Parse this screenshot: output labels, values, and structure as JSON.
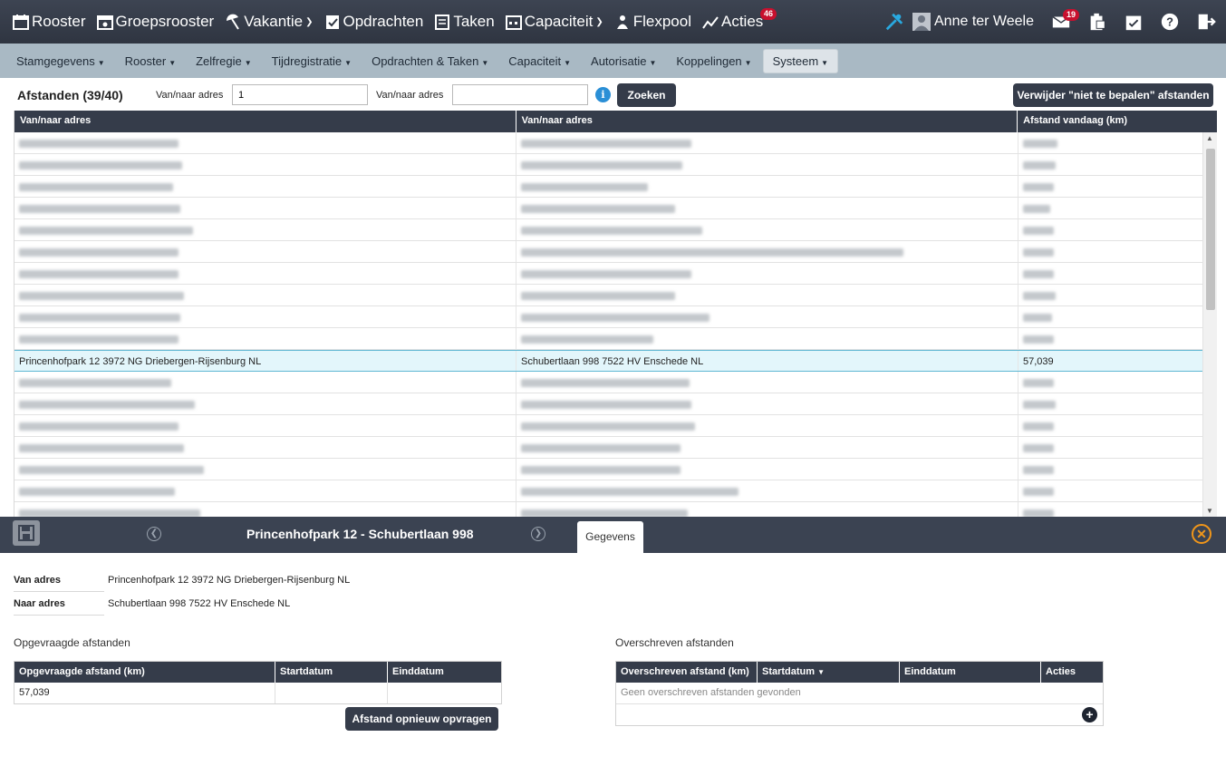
{
  "topnav": [
    {
      "label": "Rooster",
      "icon": "calendar-icon"
    },
    {
      "label": "Groepsrooster",
      "icon": "group-calendar-icon"
    },
    {
      "label": "Vakantie",
      "icon": "beach-umbrella-icon",
      "caret": true
    },
    {
      "label": "Opdrachten",
      "icon": "assignment-icon"
    },
    {
      "label": "Taken",
      "icon": "tasks-icon"
    },
    {
      "label": "Capaciteit",
      "icon": "capacity-icon",
      "caret": true
    },
    {
      "label": "Flexpool",
      "icon": "flexpool-icon"
    },
    {
      "label": "Acties",
      "icon": "actions-icon",
      "badge": "46"
    }
  ],
  "user": {
    "name": "Anne ter Weele",
    "mail_badge": "19"
  },
  "subnav": [
    {
      "label": "Stamgegevens",
      "active": false
    },
    {
      "label": "Rooster",
      "active": false
    },
    {
      "label": "Zelfregie",
      "active": false
    },
    {
      "label": "Tijdregistratie",
      "active": false
    },
    {
      "label": "Opdrachten & Taken",
      "active": false
    },
    {
      "label": "Capaciteit",
      "active": false
    },
    {
      "label": "Autorisatie",
      "active": false
    },
    {
      "label": "Koppelingen",
      "active": false
    },
    {
      "label": "Systeem",
      "active": true
    }
  ],
  "filter": {
    "title": "Afstanden (39/40)",
    "label1": "Van/naar adres",
    "value1": "1",
    "label2": "Van/naar adres",
    "value2": "",
    "search_label": "Zoeken",
    "remove_label": "Verwijder \"niet te bepalen\" afstanden"
  },
  "grid": {
    "columns": [
      "Van/naar adres",
      "Van/naar adres",
      "Afstand vandaag (km)"
    ],
    "selected_row": {
      "from": "Princenhofpark 12 3972 NG Driebergen-Rijsenburg NL",
      "to": "Schubertlaan 998 7522 HV Enschede NL",
      "distance": "57,039"
    },
    "rows_above": 10,
    "rows_below": 7
  },
  "detail": {
    "title": "Princenhofpark 12 - Schubertlaan 998",
    "tab": "Gegevens",
    "van_label": "Van adres",
    "van_value": "Princenhofpark 12 3972 NG Driebergen-Rijsenburg NL",
    "naar_label": "Naar adres",
    "naar_value": "Schubertlaan 998 7522 HV Enschede NL",
    "requested": {
      "title": "Opgevraagde afstanden",
      "columns": [
        "Opgevraagde afstand (km)",
        "Startdatum",
        "Einddatum"
      ],
      "row": {
        "distance": "57,039",
        "start": "",
        "end": ""
      },
      "button": "Afstand opnieuw opvragen"
    },
    "overwritten": {
      "title": "Overschreven afstanden",
      "columns": [
        "Overschreven afstand (km)",
        "Startdatum",
        "Einddatum",
        "Acties"
      ],
      "empty": "Geen overschreven afstanden gevonden"
    }
  },
  "colors": {
    "dark": "#353c4a",
    "subnav": "#a9b9c4",
    "selected": "#e3f6fb",
    "accent": "#f0961a"
  }
}
